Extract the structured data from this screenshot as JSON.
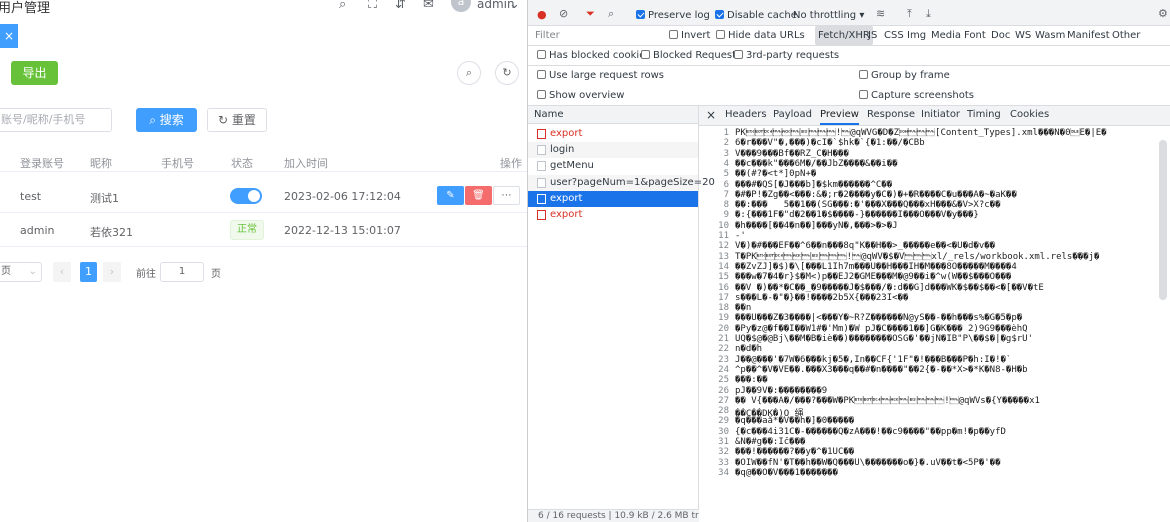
{
  "app": {
    "header": {
      "title": "用户管理",
      "user": "admin",
      "avatar_letter": "a"
    },
    "tag_close": "×",
    "toolbar": {
      "export_label": "导出"
    },
    "search": {
      "placeholder": "账号/昵称/手机号",
      "search_label": "搜索",
      "reset_label": "重置"
    },
    "table": {
      "columns": [
        "登录账号",
        "昵称",
        "手机号",
        "状态",
        "加入时间",
        "操作"
      ],
      "rows": [
        {
          "account": "test",
          "nickname": "测试1",
          "phone": "",
          "status": "switch-on",
          "joined": "2023-02-06 17:12:04"
        },
        {
          "account": "admin",
          "nickname": "若依321",
          "phone": "",
          "status": "正常",
          "joined": "2022-12-13 15:01:07"
        }
      ]
    },
    "pagination": {
      "page_size_suffix": "页",
      "current_page": "1",
      "goto_label": "前往",
      "goto_value": "1",
      "page_suffix": "页"
    }
  },
  "devtools": {
    "toolbar": {
      "preserve_log": "Preserve log",
      "disable_cache": "Disable cache",
      "throttling": "No throttling"
    },
    "filter": {
      "placeholder": "Filter",
      "invert": "Invert",
      "hide_data_urls": "Hide data URLs",
      "types": [
        "Fetch/XHR",
        "JS",
        "CSS",
        "Img",
        "Media",
        "Font",
        "Doc",
        "WS",
        "Wasm",
        "Manifest",
        "Other"
      ],
      "has_blocked_cookies": "Has blocked cookies",
      "blocked_requests": "Blocked Requests",
      "third_party": "3rd-party requests"
    },
    "options": {
      "large_rows": "Use large request rows",
      "group_by_frame": "Group by frame",
      "show_overview": "Show overview",
      "capture_screenshots": "Capture screenshots"
    },
    "list_header": "Name",
    "requests": [
      {
        "name": "export",
        "state": "error"
      },
      {
        "name": "login",
        "state": "normal"
      },
      {
        "name": "getMenu",
        "state": "normal"
      },
      {
        "name": "user?pageNum=1&pageSize=20",
        "state": "normal"
      },
      {
        "name": "export",
        "state": "selected"
      },
      {
        "name": "export",
        "state": "error"
      }
    ],
    "status_bar": "6 / 16 requests | 10.9 kB / 2.6 MB tran",
    "detail_tabs": [
      "×",
      "Headers",
      "Payload",
      "Preview",
      "Response",
      "Initiator",
      "Timing",
      "Cookies"
    ],
    "preview_lines": [
      "PK\u0003\u0004\u0014\u0000\u0006\u0000\b\u0000\u0000\u0000!\u0000@qWVG�D�Z\u0001\u0000\u0000\u0000[Content_Types].xml���N�0\u0010E�|E�",
      "6�r���V\"�,���)�cI�`$hk�`{�1:��/�CBb",
      "V���9���Bf��RZ_C�H���",
      "��c���k\"���6M�/��JbZ����&��i��",
      "��(#?�<t*]0pN+�",
      "���#�QS[�J���b]�$km������^C��",
      "�#�P!�Zg��<���:&�;r�2����y�C�)�+�R����C�u���A�~�aK��",
      "��:���   5��1��(SG���:�'���X���Q���xH���&�V>X?c��",
      "�:{���1F�\"d�2��1�$����-}������I���O���V�y���}",
      "�h����[��4�n��]���yN�,���>�>�J",
      "-'",
      "V�)�#���EF��^6��n���8q\"K��H��>_�����e��<�U�d�v��",
      "T�PK\u0003\u0004\u0014\u0000\u0006\u0000\b\u0000\u0000\u0000!\u0000@qWV�$�V\u0000\u0000\u0000xl/_rels/workbook.xml.rels���j�",
      "��ZvZJ]�$)�\\[���L1Ih7m���U��H���IH�M���8O�����M����4",
      "���w�7�4�r}$�M<)p��EJ2�GME���M�@9��i�^w(W��$���O���",
      "��V �)��*�C��_�9�����J�$���/�:d��G]d���WK�$��$��<�[��V�tE",
      "s���L�-�\"�}��!����2b5X{���23I<��",
      "��n",
      "���U���Z�3����|<���Y�~R?Z������N@yS��-��h���s%�G�5�p�",
      "�Py�z@�f��I��W1#�'Mm)�W pJ�C����1��]G�K��� 2)9G9���èhQ",
      "UQ�$@�@Bj\\��M�B�iè��)��������OSG�'��jN�IB\"P\\��$�|�g$rU'",
      "n�d�h",
      "J��@���'�7W�6���kj�5�,In��CF{'1F\"�!���B���P�h:I�!�`",
      "^p��^�V�VE��.���X3���q��#�n����\"��2{�-��*X>�*K�N8-�H�b",
      "���:��",
      "pJ��9V�:��������9",
      "�� V{���A�/���?���W�PK\u0003\u0004\u0014\u0000\u0006\u0000\b\u0000\u0000\u0000!\u0000@qWVs�{Y�����x1",
      "��C��DK�)Q 绳",
      "�q���aå*�V��h�]�0�����",
      "{�c���4i31C�-������Q�zA���!��c9����\"��pp�m!�p��yfD",
      "&N�#g��:Ič���",
      "���!������?��y�^�1UC��",
      "�OIW��fN'�T��h��W�Q���U\\�������o�}�.uV��t�<5P�'��",
      "�q@��O�V���1�������"
    ]
  }
}
